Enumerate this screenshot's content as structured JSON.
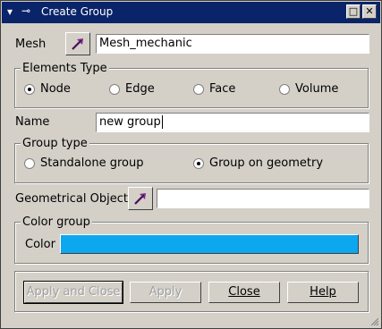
{
  "window": {
    "title": "Create Group",
    "app_icon": "mesh-app-icon",
    "pin_icon": "pin-icon",
    "maximize_label": "□",
    "close_label": "✕"
  },
  "mesh": {
    "label": "Mesh",
    "value": "Mesh_mechanic"
  },
  "elements_type": {
    "title": "Elements Type",
    "options": [
      "Node",
      "Edge",
      "Face",
      "Volume"
    ],
    "selected": "Node"
  },
  "name": {
    "label": "Name",
    "value": "new group"
  },
  "group_type": {
    "title": "Group type",
    "options": [
      "Standalone group",
      "Group on geometry"
    ],
    "selected": "Group on geometry"
  },
  "geom": {
    "label": "Geometrical Object",
    "value": ""
  },
  "color_group": {
    "title": "Color group",
    "label": "Color",
    "color": "#0da7f0"
  },
  "buttons": {
    "apply_close": "Apply and Close",
    "apply": "Apply",
    "close": "Close",
    "help": "Help"
  },
  "colors": {
    "titlebar": "#0a246a",
    "dialog": "#d4d0c8",
    "selection_arrow": "#7b2c8c"
  }
}
